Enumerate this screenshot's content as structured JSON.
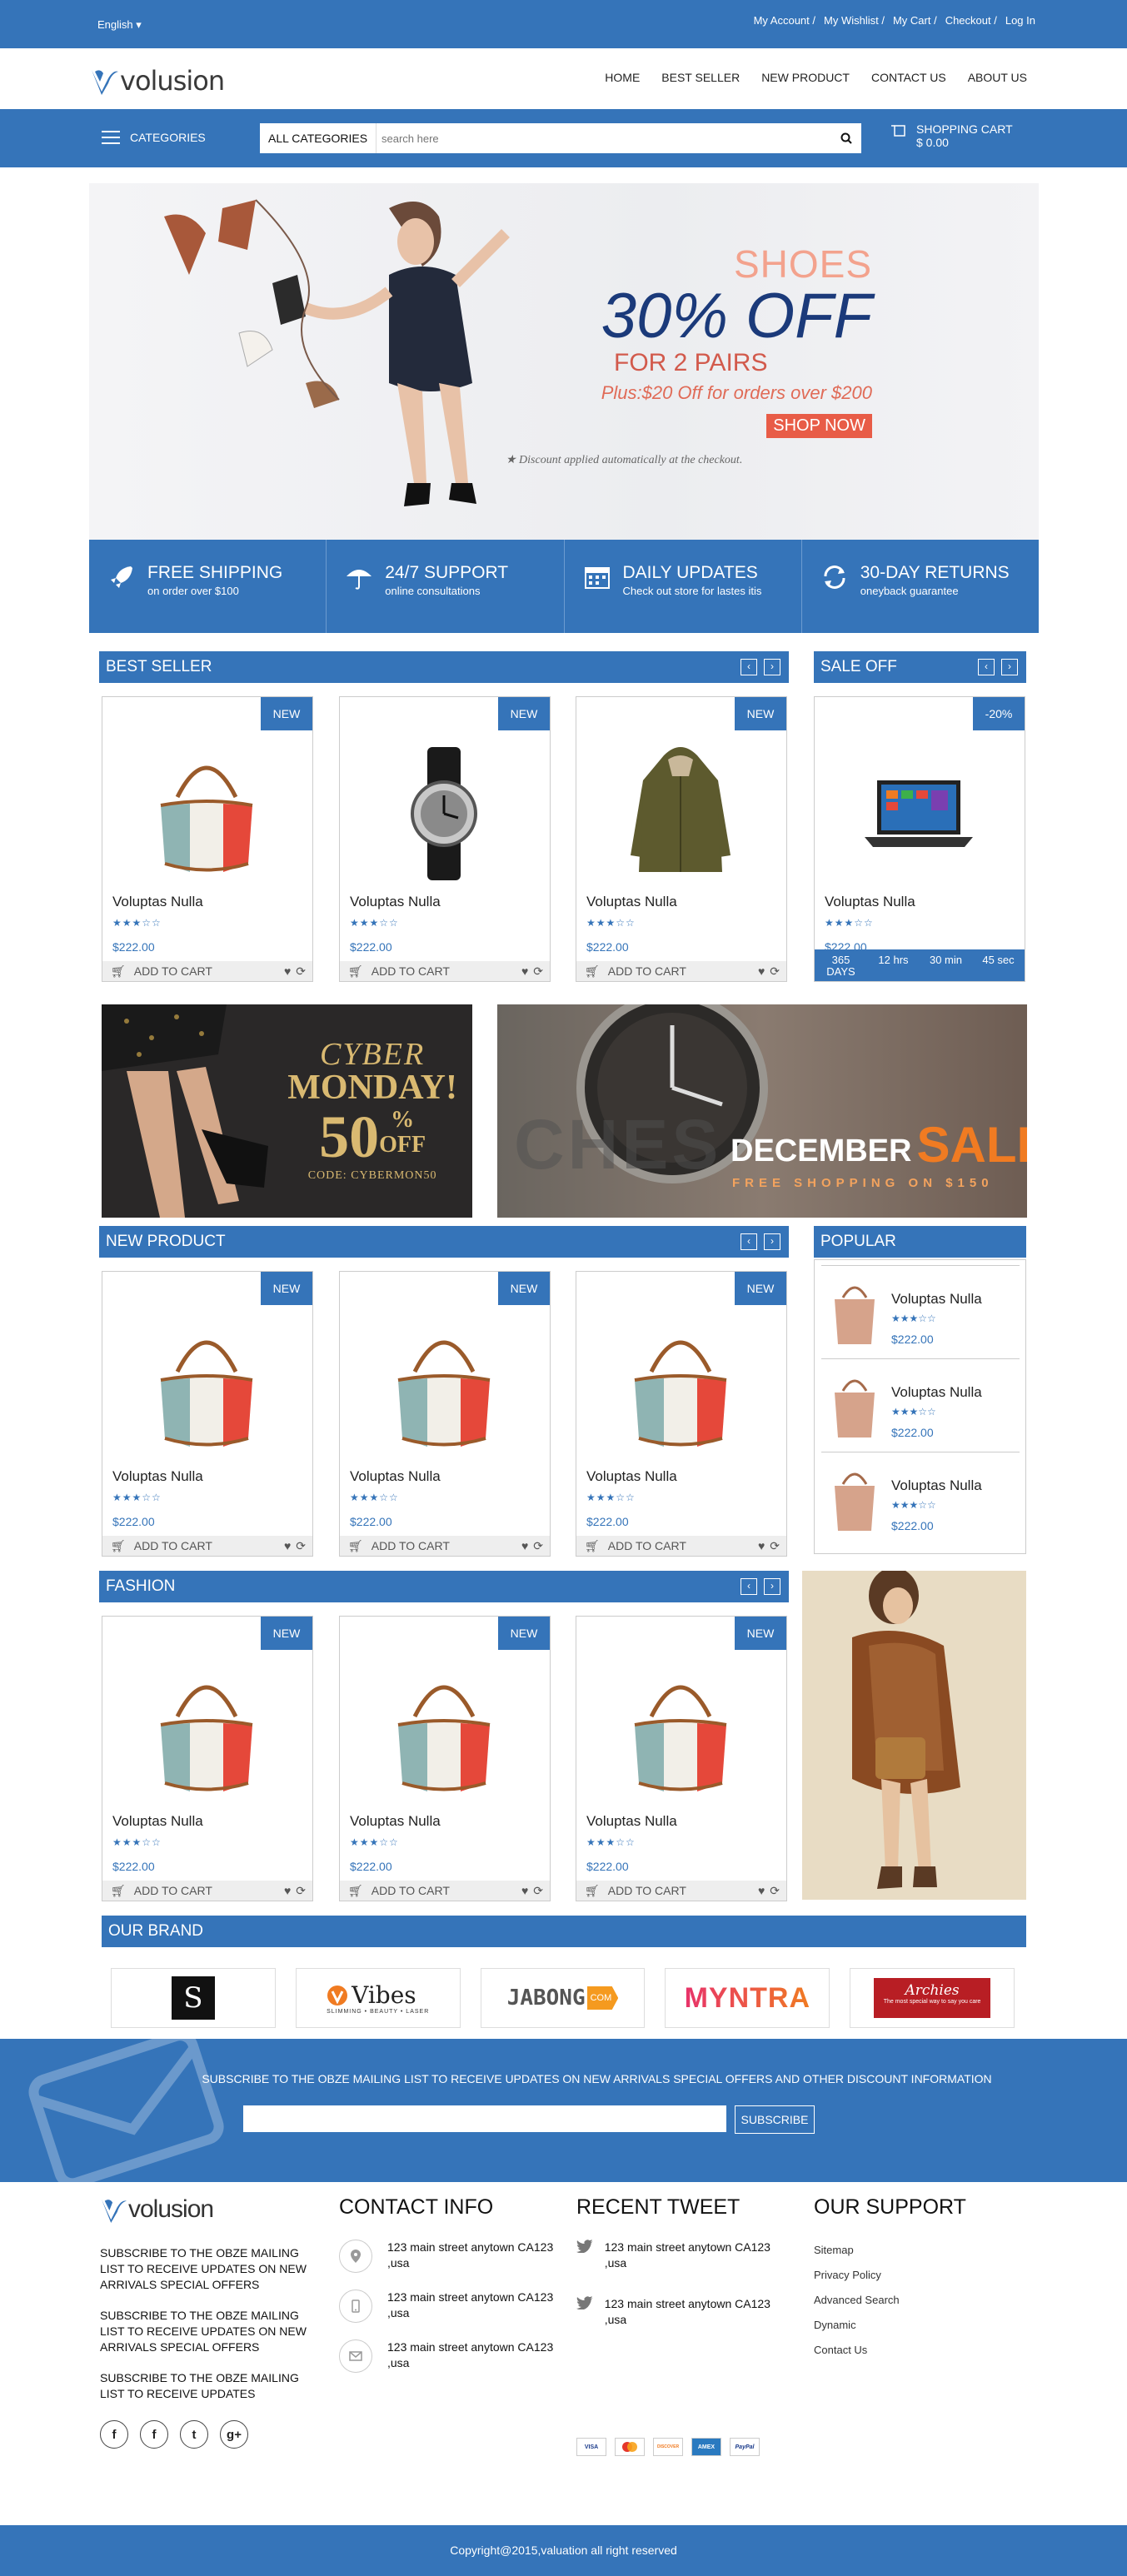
{
  "topbar": {
    "language": "English",
    "links": [
      "My Account /",
      "My Wishlist /",
      "My Cart /",
      "Checkout /",
      "Log In"
    ]
  },
  "header": {
    "logo_text": "volusion",
    "nav": [
      "HOME",
      "BEST SELLER",
      "NEW PRODUCT",
      "CONTACT US",
      "ABOUT US"
    ]
  },
  "catbar": {
    "categories_label": "CATEGORIES",
    "all_categories": "ALL CATEGORIES",
    "search_placeholder": "search here",
    "cart_label": "SHOPPING CART",
    "cart_total": "$ 0.00"
  },
  "hero": {
    "line1": "SHOES",
    "line2": "30% OFF",
    "line3": "FOR 2 PAIRS",
    "line4": "Plus:$20 Off for orders over $200",
    "button": "SHOP NOW",
    "note": "★ Discount applied automatically at the checkout."
  },
  "features": [
    {
      "icon": "rocket-icon",
      "title": "FREE SHIPPING",
      "sub": "on order over $100"
    },
    {
      "icon": "umbrella-icon",
      "title": "24/7 SUPPORT",
      "sub": "online consultations"
    },
    {
      "icon": "calendar-icon",
      "title": "DAILY UPDATES",
      "sub": "Check out store for lastes itis"
    },
    {
      "icon": "refresh-icon",
      "title": "30-DAY RETURNS",
      "sub": "oneyback guarantee"
    }
  ],
  "sections": {
    "best_seller": "BEST SELLER",
    "sale_off": "SALE OFF",
    "new_product": "NEW PRODUCT",
    "popular": "POPULAR",
    "fashion": "FASHION",
    "our_brand": "OUR BRAND"
  },
  "product": {
    "badge": "NEW",
    "name": "Voluptas Nulla",
    "price": "$222.00",
    "add_to_cart": "ADD TO CART",
    "rating": 3
  },
  "sale": {
    "badge": "-20%",
    "name": "Voluptas Nulla",
    "price": "$222.00",
    "countdown": [
      {
        "v": "365",
        "u": "DAYS"
      },
      {
        "v": "12 hrs",
        "u": ""
      },
      {
        "v": "30 min",
        "u": ""
      },
      {
        "v": "45 sec",
        "u": ""
      }
    ]
  },
  "promo1": {
    "l1": "CYBER",
    "l2": "MONDAY!",
    "l3": "50",
    "l4": "%",
    "l5": "OFF",
    "l6": "CODE: CYBERMON50"
  },
  "promo2": {
    "bg": "CHES",
    "l1": "DECEMBER",
    "l2": "SALE",
    "l3": "FREE SHOPPING ON $150"
  },
  "brands": [
    "S",
    "Vibes",
    "JABONG",
    "MYNTRA",
    "Archies"
  ],
  "brand_sub": {
    "vibes": "SLIMMING • BEAUTY • LASER",
    "archies": "The most special way to say you care"
  },
  "newsletter": {
    "message": "SUBSCRIBE TO THE OBZE MAILING LIST TO RECEIVE UPDATES ON NEW ARRIVALS SPECIAL OFFERS AND OTHER DISCOUNT INFORMATION",
    "button": "SUBSCRIBE"
  },
  "footer": {
    "about": [
      "SUBSCRIBE TO THE OBZE MAILING LIST TO RECEIVE UPDATES ON NEW ARRIVALS SPECIAL OFFERS",
      "SUBSCRIBE TO THE OBZE MAILING LIST TO RECEIVE UPDATES ON NEW ARRIVALS SPECIAL OFFERS",
      "SUBSCRIBE TO THE OBZE MAILING LIST TO RECEIVE UPDATES"
    ],
    "contact_title": "CONTACT INFO",
    "contact": [
      "123 main street anytown CA123 ,usa",
      "123 main street anytown CA123 ,usa",
      "123 main street anytown CA123 ,usa"
    ],
    "tweet_title": "RECENT TWEET",
    "tweets": [
      "123 main street anytown CA123 ,usa",
      "123 main street anytown CA123 ,usa"
    ],
    "support_title": "OUR SUPPORT",
    "support_links": [
      "Sitemap",
      "Privacy Policy",
      "Advanced Search",
      "Dynamic",
      "Contact Us"
    ],
    "social": [
      "f",
      "f",
      "t",
      "g+"
    ],
    "payments": [
      "VISA",
      "MC",
      "DISCOVER",
      "AMEX",
      "PayPal"
    ],
    "copyright": "Copyright@2015,valuation all right reserved"
  },
  "colors": {
    "accent": "#3574b9",
    "sale": "#f07b22"
  }
}
